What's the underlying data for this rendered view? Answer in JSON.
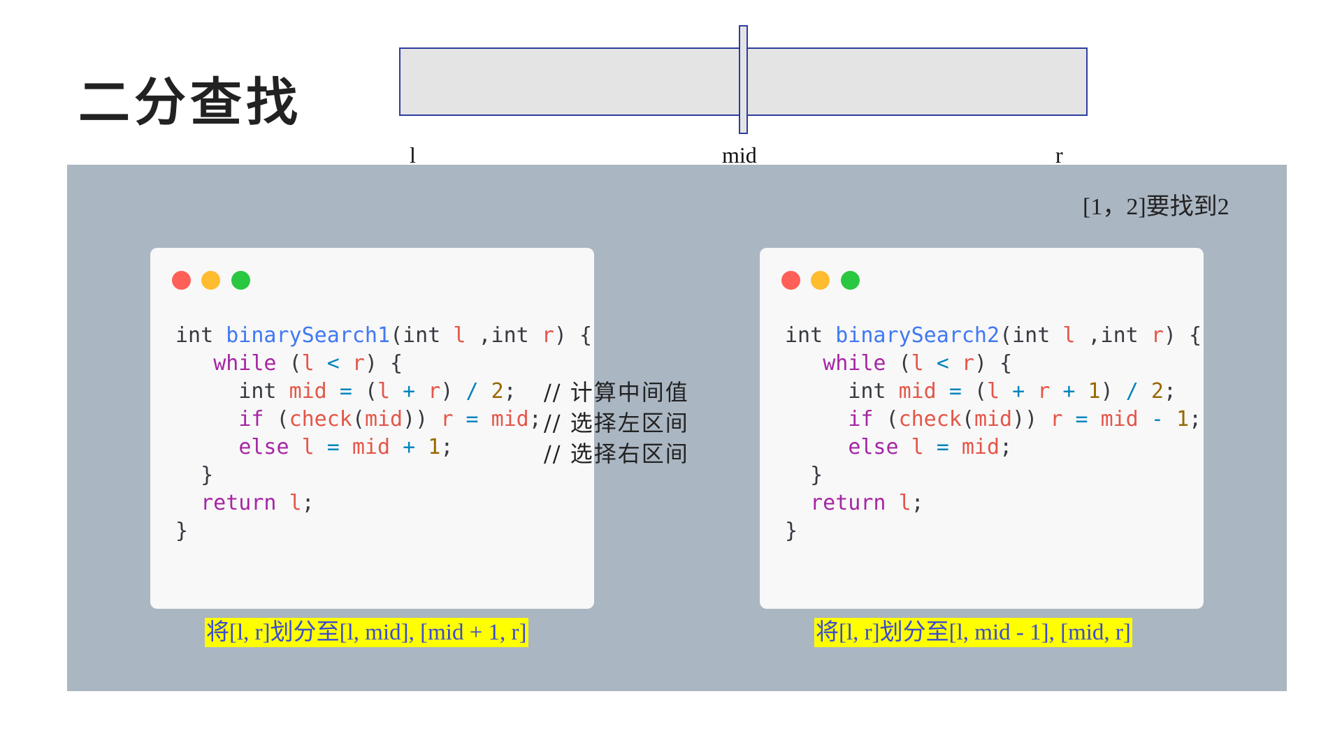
{
  "title": "二分查找",
  "pointers": {
    "left": "l",
    "mid": "mid",
    "right": "r"
  },
  "range_note": "[1，2]要找到2",
  "comments": [
    "// 计算中间值",
    "// 选择左区间",
    "// 选择右区间"
  ],
  "captions": {
    "left": "将[l, r]划分至[l, mid], [mid + 1, r]",
    "right": "将[l, r]划分至[l, mid - 1], [mid, r]"
  },
  "window_controls": [
    "close-dot",
    "minimize-dot",
    "maximize-dot"
  ],
  "colors": {
    "panel_bg": "#aab6c2",
    "code_bg": "#f8f8f8",
    "caption_highlight": "#ffff00",
    "caption_text": "#3a4bd0",
    "bar_border": "#2e3c9e",
    "keyword": "#a626a4",
    "function": "#4078f2",
    "variable": "#e45649",
    "operator": "#0184bc",
    "number": "#986801"
  },
  "code_blocks": [
    {
      "lines": [
        [
          [
            "",
            "int "
          ],
          [
            "fn",
            "binarySearch1"
          ],
          [
            "",
            "(int "
          ],
          [
            "var",
            "l"
          ],
          [
            "",
            " ,int "
          ],
          [
            "var",
            "r"
          ],
          [
            "",
            ") {"
          ]
        ],
        [
          [
            "",
            "   "
          ],
          [
            "kw",
            "while"
          ],
          [
            "",
            " ("
          ],
          [
            "var",
            "l"
          ],
          [
            "",
            " "
          ],
          [
            "op",
            "<"
          ],
          [
            "",
            " "
          ],
          [
            "var",
            "r"
          ],
          [
            "",
            ") {"
          ]
        ],
        [
          [
            "",
            "     int "
          ],
          [
            "var",
            "mid"
          ],
          [
            "",
            " "
          ],
          [
            "op",
            "="
          ],
          [
            "",
            " ("
          ],
          [
            "var",
            "l"
          ],
          [
            "",
            " "
          ],
          [
            "op",
            "+"
          ],
          [
            "",
            " "
          ],
          [
            "var",
            "r"
          ],
          [
            "",
            ") "
          ],
          [
            "op",
            "/"
          ],
          [
            "",
            " "
          ],
          [
            "num",
            "2"
          ],
          [
            "",
            ";"
          ]
        ],
        [
          [
            "",
            "     "
          ],
          [
            "kw",
            "if"
          ],
          [
            "",
            " ("
          ],
          [
            "var",
            "check"
          ],
          [
            "",
            "("
          ],
          [
            "var",
            "mid"
          ],
          [
            "",
            ")) "
          ],
          [
            "var",
            "r"
          ],
          [
            "",
            " "
          ],
          [
            "op",
            "="
          ],
          [
            "",
            " "
          ],
          [
            "var",
            "mid"
          ],
          [
            "",
            ";"
          ]
        ],
        [
          [
            "",
            "     "
          ],
          [
            "kw",
            "else"
          ],
          [
            "",
            " "
          ],
          [
            "var",
            "l"
          ],
          [
            "",
            " "
          ],
          [
            "op",
            "="
          ],
          [
            "",
            " "
          ],
          [
            "var",
            "mid"
          ],
          [
            "",
            " "
          ],
          [
            "op",
            "+"
          ],
          [
            "",
            " "
          ],
          [
            "num",
            "1"
          ],
          [
            "",
            ";"
          ]
        ],
        [
          [
            "",
            "  }"
          ]
        ],
        [
          [
            "",
            "  "
          ],
          [
            "kw",
            "return"
          ],
          [
            "",
            " "
          ],
          [
            "var",
            "l"
          ],
          [
            "",
            ";"
          ]
        ],
        [
          [
            "",
            "}"
          ]
        ]
      ]
    },
    {
      "lines": [
        [
          [
            "",
            "int "
          ],
          [
            "fn",
            "binarySearch2"
          ],
          [
            "",
            "(int "
          ],
          [
            "var",
            "l"
          ],
          [
            "",
            " ,int "
          ],
          [
            "var",
            "r"
          ],
          [
            "",
            ") {"
          ]
        ],
        [
          [
            "",
            "   "
          ],
          [
            "kw",
            "while"
          ],
          [
            "",
            " ("
          ],
          [
            "var",
            "l"
          ],
          [
            "",
            " "
          ],
          [
            "op",
            "<"
          ],
          [
            "",
            " "
          ],
          [
            "var",
            "r"
          ],
          [
            "",
            ") {"
          ]
        ],
        [
          [
            "",
            "     int "
          ],
          [
            "var",
            "mid"
          ],
          [
            "",
            " "
          ],
          [
            "op",
            "="
          ],
          [
            "",
            " ("
          ],
          [
            "var",
            "l"
          ],
          [
            "",
            " "
          ],
          [
            "op",
            "+"
          ],
          [
            "",
            " "
          ],
          [
            "var",
            "r"
          ],
          [
            "",
            " "
          ],
          [
            "op",
            "+"
          ],
          [
            "",
            " "
          ],
          [
            "num",
            "1"
          ],
          [
            "",
            ") "
          ],
          [
            "op",
            "/"
          ],
          [
            "",
            " "
          ],
          [
            "num",
            "2"
          ],
          [
            "",
            ";"
          ]
        ],
        [
          [
            "",
            "     "
          ],
          [
            "kw",
            "if"
          ],
          [
            "",
            " ("
          ],
          [
            "var",
            "check"
          ],
          [
            "",
            "("
          ],
          [
            "var",
            "mid"
          ],
          [
            "",
            ")) "
          ],
          [
            "var",
            "r"
          ],
          [
            "",
            " "
          ],
          [
            "op",
            "="
          ],
          [
            "",
            " "
          ],
          [
            "var",
            "mid"
          ],
          [
            "",
            " "
          ],
          [
            "op",
            "-"
          ],
          [
            "",
            " "
          ],
          [
            "num",
            "1"
          ],
          [
            "",
            ";"
          ]
        ],
        [
          [
            "",
            "     "
          ],
          [
            "kw",
            "else"
          ],
          [
            "",
            " "
          ],
          [
            "var",
            "l"
          ],
          [
            "",
            " "
          ],
          [
            "op",
            "="
          ],
          [
            "",
            " "
          ],
          [
            "var",
            "mid"
          ],
          [
            "",
            ";"
          ]
        ],
        [
          [
            "",
            "  }"
          ]
        ],
        [
          [
            "",
            "  "
          ],
          [
            "kw",
            "return"
          ],
          [
            "",
            " "
          ],
          [
            "var",
            "l"
          ],
          [
            "",
            ";"
          ]
        ],
        [
          [
            "",
            "}"
          ]
        ]
      ]
    }
  ]
}
